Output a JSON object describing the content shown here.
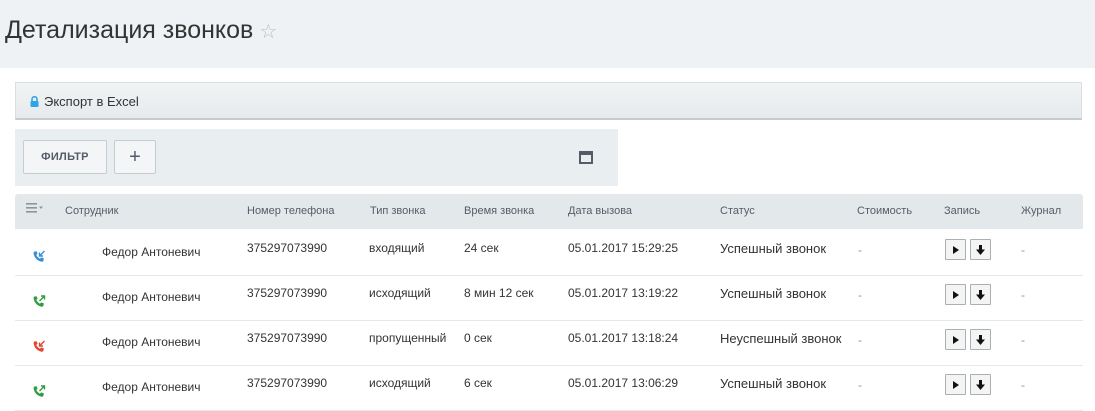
{
  "page": {
    "title": "Детализация звонков",
    "star_icon": "star-icon"
  },
  "export": {
    "label": "Экспорт в Excel",
    "icon": "lock-icon"
  },
  "toolbar": {
    "filter_label": "ФИЛЬТР",
    "add_label": "+",
    "window_icon": "window-icon"
  },
  "table": {
    "columns": [
      "Сотрудник",
      "Номер телефона",
      "Тип звонка",
      "Время звонка",
      "Дата вызова",
      "Статус",
      "Стоимость",
      "Запись",
      "Журнал"
    ],
    "rows": [
      {
        "call_icon": "incoming-call-icon",
        "icon_color": "#3a8fd4",
        "employee": "Федор Антоневич",
        "phone": "375297073990",
        "type": "входящий",
        "duration": "24 сек",
        "date": "05.01.2017 15:29:25",
        "status": "Успешный звонок",
        "cost": "-",
        "journal": "-"
      },
      {
        "call_icon": "outgoing-call-icon",
        "icon_color": "#2f9c3f",
        "employee": "Федор Антоневич",
        "phone": "375297073990",
        "type": "исходящий",
        "duration": "8 мин 12 сек",
        "date": "05.01.2017 13:19:22",
        "status": "Успешный звонок",
        "cost": "-",
        "journal": "-"
      },
      {
        "call_icon": "missed-call-icon",
        "icon_color": "#e2462f",
        "employee": "Федор Антоневич",
        "phone": "375297073990",
        "type": "пропущенный",
        "duration": "0 сек",
        "date": "05.01.2017 13:18:24",
        "status": "Неуспешный звонок",
        "cost": "-",
        "journal": "-"
      },
      {
        "call_icon": "outgoing-call-icon",
        "icon_color": "#2f9c3f",
        "employee": "Федор Антоневич",
        "phone": "375297073990",
        "type": "исходящий",
        "duration": "6 сек",
        "date": "05.01.2017 13:06:29",
        "status": "Успешный звонок",
        "cost": "-",
        "journal": "-"
      }
    ]
  }
}
